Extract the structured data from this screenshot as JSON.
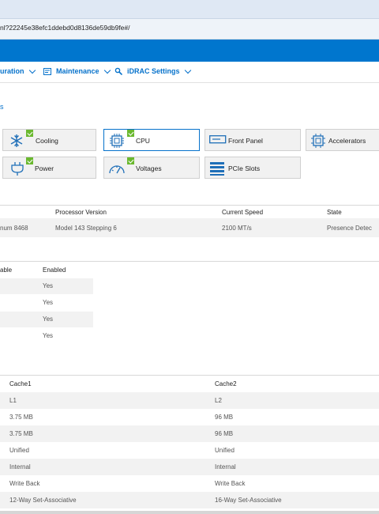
{
  "browser": {
    "url_fragment": "nl?22245e38efc1ddebd0d8136de59db9fe#/"
  },
  "menu": [
    {
      "label": "uration",
      "icon": ""
    },
    {
      "label": "Maintenance",
      "icon": "maintenance-icon"
    },
    {
      "label": "iDRAC Settings",
      "icon": "idrac-settings-icon"
    }
  ],
  "breadcrumb": "s",
  "components": {
    "cooling": "Cooling",
    "cpu": "CPU",
    "front_panel": "Front Panel",
    "accelerators": "Accelerators",
    "power": "Power",
    "voltages": "Voltages",
    "pcie_slots": "PCIe Slots"
  },
  "processor_table": {
    "headers": {
      "version": "Processor Version",
      "speed": "Current Speed",
      "state": "State"
    },
    "row": {
      "model": "num 8468",
      "version": "Model 143 Stepping 6",
      "speed": "2100 MT/s",
      "state": "Presence Detec"
    }
  },
  "feature_table": {
    "headers": {
      "capable": "able",
      "enabled": "Enabled"
    },
    "rows": [
      "Yes",
      "Yes",
      "Yes",
      "Yes"
    ]
  },
  "cache_table": {
    "headers": {
      "cache1": "Cache1",
      "cache2": "Cache2"
    },
    "rows": [
      [
        "L1",
        "L2"
      ],
      [
        "3.75 MB",
        "96 MB"
      ],
      [
        "3.75 MB",
        "96 MB"
      ],
      [
        "Unified",
        "Unified"
      ],
      [
        "Internal",
        "Internal"
      ],
      [
        "Write Back",
        "Write Back"
      ],
      [
        "12-Way Set-Associative",
        "16-Way Set-Associative"
      ]
    ]
  },
  "colors": {
    "brand_blue": "#0076ce",
    "link_blue": "#0672cb",
    "check_green": "#6ab82f"
  }
}
